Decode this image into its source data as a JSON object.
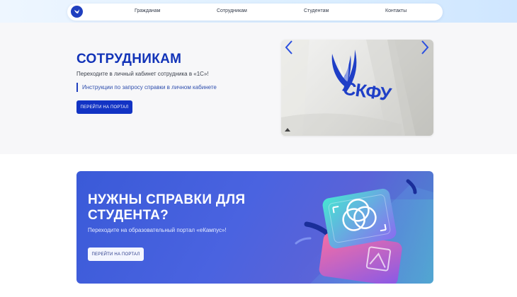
{
  "nav": {
    "items": [
      "Гражданам",
      "Сотрудникам",
      "Студентам",
      "Контакты"
    ]
  },
  "hero": {
    "title": "СОТРУДНИКАМ",
    "subtitle": "Переходите в личный кабинет сотрудника в «1С»!",
    "link": "Инструкции по запросу справки в личном кабинете",
    "button": "ПЕРЕЙТИ НА ПОРТАЛ",
    "photo_text": "СКФУ"
  },
  "banner": {
    "title": "НУЖНЫ СПРАВКИ ДЛЯ СТУДЕНТА?",
    "subtitle": "Переходите на образовательный портал «еКампус»!",
    "button": "ПЕРЕЙТИ НА ПОРТАЛ"
  },
  "colors": {
    "brand": "#1233b8",
    "banner_start": "#3a5ad8",
    "banner_end": "#4b8ccc",
    "accent_teal": "#28c8c0"
  },
  "icons": {
    "logo": "university-logo-icon",
    "prev": "chevron-left-icon",
    "next": "chevron-right-icon"
  }
}
